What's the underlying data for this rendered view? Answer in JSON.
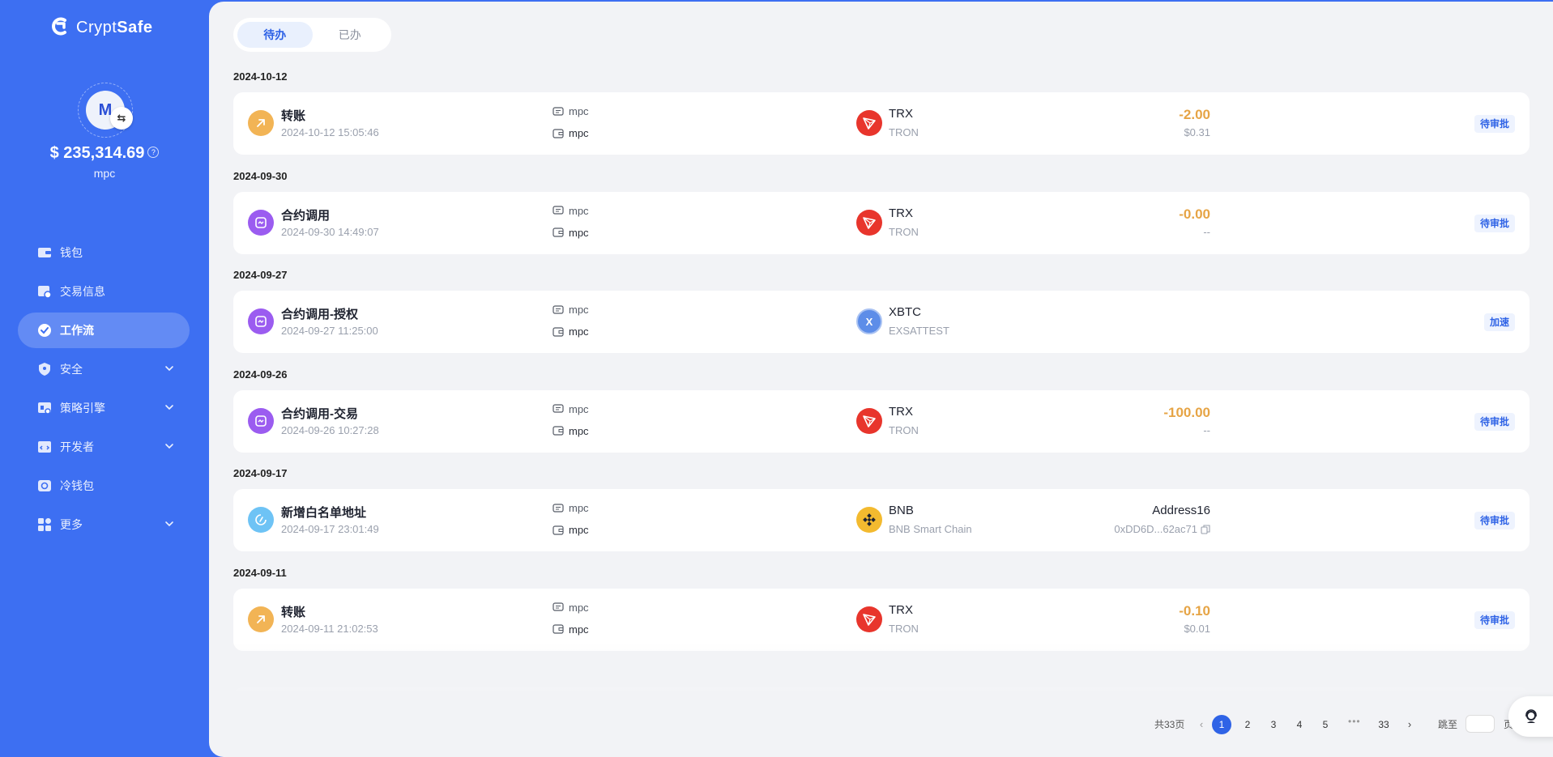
{
  "app": {
    "brand_light": "Crypt",
    "brand_bold": "Safe"
  },
  "profile": {
    "avatar_letter": "M",
    "swap_icon": "⇆",
    "balance": "$ 235,314.69",
    "help_icon": "?",
    "account": "mpc"
  },
  "sidebar": {
    "items": [
      {
        "label": "钱包",
        "icon": "wallet-icon",
        "expandable": false,
        "active": false
      },
      {
        "label": "交易信息",
        "icon": "transaction-icon",
        "expandable": false,
        "active": false
      },
      {
        "label": "工作流",
        "icon": "workflow-check-icon",
        "expandable": false,
        "active": true
      },
      {
        "label": "安全",
        "icon": "shield-icon",
        "expandable": true,
        "active": false
      },
      {
        "label": "策略引擎",
        "icon": "strategy-icon",
        "expandable": true,
        "active": false
      },
      {
        "label": "开发者",
        "icon": "developer-icon",
        "expandable": true,
        "active": false
      },
      {
        "label": "冷钱包",
        "icon": "cold-wallet-icon",
        "expandable": false,
        "active": false
      },
      {
        "label": "更多",
        "icon": "more-grid-icon",
        "expandable": true,
        "active": false
      }
    ]
  },
  "tabs": [
    {
      "label": "待办",
      "active": true
    },
    {
      "label": "已办",
      "active": false
    }
  ],
  "groups": [
    {
      "date": "2024-10-12",
      "item": {
        "title": "转账",
        "time": "2024-10-12 15:05:46",
        "icon": "transfer-icon",
        "icon_color": "orange",
        "account_1": "mpc",
        "account_2": "mpc",
        "coin": "TRX",
        "coin_logo": "trx",
        "chain": "TRON",
        "amount": "-2.00",
        "amount_sub": "$0.31",
        "is_address": false,
        "status": "待审批"
      }
    },
    {
      "date": "2024-09-30",
      "item": {
        "title": "合约调用",
        "time": "2024-09-30 14:49:07",
        "icon": "contract-icon",
        "icon_color": "purple",
        "account_1": "mpc",
        "account_2": "mpc",
        "coin": "TRX",
        "coin_logo": "trx",
        "chain": "TRON",
        "amount": "-0.00",
        "amount_sub": "--",
        "is_address": false,
        "status": "待审批"
      }
    },
    {
      "date": "2024-09-27",
      "item": {
        "title": "合约调用-授权",
        "time": "2024-09-27 11:25:00",
        "icon": "contract-icon",
        "icon_color": "purple",
        "account_1": "mpc",
        "account_2": "mpc",
        "coin": "XBTC",
        "coin_logo": "xbtc",
        "coin_letter": "X",
        "chain": "EXSATTEST",
        "amount": "",
        "amount_sub": "",
        "is_address": false,
        "status": "加速"
      }
    },
    {
      "date": "2024-09-26",
      "item": {
        "title": "合约调用-交易",
        "time": "2024-09-26 10:27:28",
        "icon": "contract-icon",
        "icon_color": "purple",
        "account_1": "mpc",
        "account_2": "mpc",
        "coin": "TRX",
        "coin_logo": "trx",
        "chain": "TRON",
        "amount": "-100.00",
        "amount_sub": "--",
        "is_address": false,
        "status": "待审批"
      }
    },
    {
      "date": "2024-09-17",
      "item": {
        "title": "新增白名单地址",
        "time": "2024-09-17 23:01:49",
        "icon": "whitelist-icon",
        "icon_color": "blue",
        "account_1": "mpc",
        "account_2": "mpc",
        "coin": "BNB",
        "coin_logo": "bnb",
        "chain": "BNB Smart Chain",
        "amount": "Address16",
        "amount_sub": "0xDD6D...62ac71",
        "is_address": true,
        "status": "待审批"
      }
    },
    {
      "date": "2024-09-11",
      "item": {
        "title": "转账",
        "time": "2024-09-11 21:02:53",
        "icon": "transfer-icon",
        "icon_color": "orange",
        "account_1": "mpc",
        "account_2": "mpc",
        "coin": "TRX",
        "coin_logo": "trx",
        "chain": "TRON",
        "amount": "-0.10",
        "amount_sub": "$0.01",
        "is_address": false,
        "status": "待审批"
      }
    },
    {
      "date": "",
      "item": {
        "title": "转账",
        "time": "",
        "icon": "transfer-icon",
        "icon_color": "orange",
        "account_1": "mpc",
        "account_2": "",
        "coin": "TRX",
        "coin_logo": "trx",
        "chain": "",
        "amount": "-0.10",
        "amount_sub": "",
        "is_address": false,
        "status": "待审批"
      }
    }
  ],
  "pagination": {
    "total": "共33页",
    "pages": [
      "1",
      "2",
      "3",
      "4",
      "5"
    ],
    "current": "1",
    "ellipsis": "•••",
    "last": "33",
    "jump_label": "跳至",
    "jump_value": "",
    "unit": "页",
    "prev_icon": "‹",
    "next_icon": "›"
  },
  "colors": {
    "brand": "#3d6ff2",
    "accent": "#2f63e6",
    "amount": "#e6a445"
  }
}
